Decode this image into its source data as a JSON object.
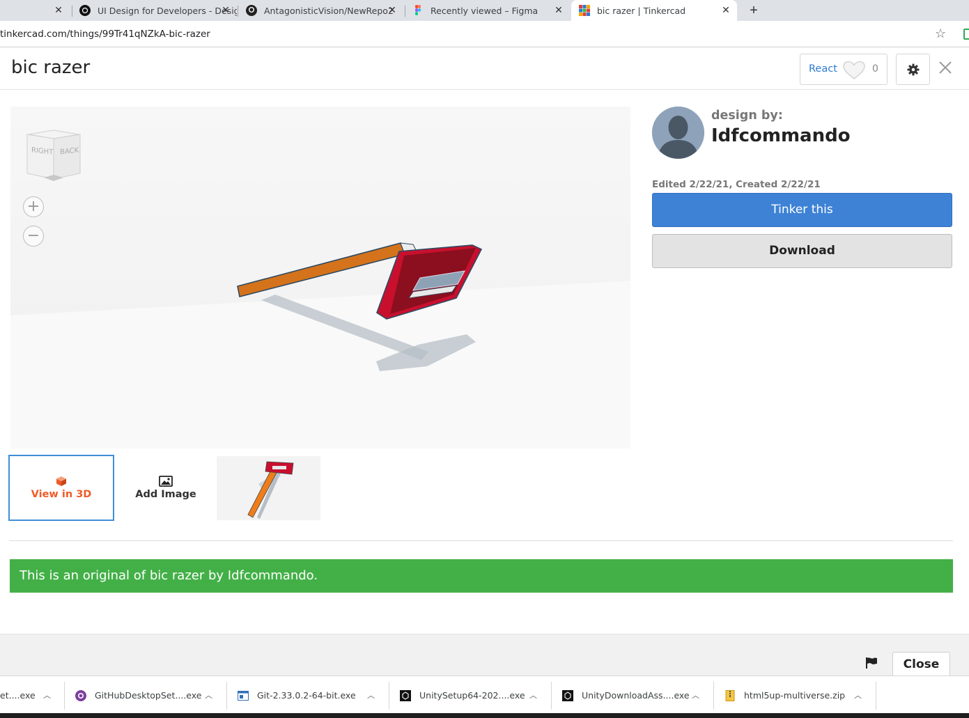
{
  "browser": {
    "tabs": [
      {
        "title": "",
        "active": false
      },
      {
        "title": "UI Design for Developers - Desig",
        "active": false
      },
      {
        "title": "AntagonisticVision/NewRepo2",
        "active": false
      },
      {
        "title": "Recently viewed – Figma",
        "active": false
      },
      {
        "title": "bic razer | Tinkercad",
        "active": true
      }
    ],
    "new_tab": "+",
    "url": "tinkercad.com/things/99Tr41qNZkA-bic-razer"
  },
  "modal": {
    "title": "bic razer",
    "react_label": "React",
    "react_count": "0",
    "viewcube": {
      "right": "RIGHT",
      "back": "BACK"
    },
    "zoom_in": "+",
    "zoom_out": "−",
    "thumbs": {
      "view3d_label": "View in 3D",
      "add_image_label": "Add Image"
    },
    "designer": {
      "design_by": "design by:",
      "name": "Idfcommando",
      "edited": "Edited 2/22/21, Created 2/22/21"
    },
    "tinker_label": "Tinker this",
    "download_label": "Download",
    "banner": "This is an original of bic razer by Idfcommando.",
    "close_label": "Close"
  },
  "downloads": [
    {
      "name": "et....exe",
      "icon": "exe-icon"
    },
    {
      "name": "GitHubDesktopSet....exe",
      "icon": "github-icon"
    },
    {
      "name": "Git-2.33.0.2-64-bit.exe",
      "icon": "installer-icon"
    },
    {
      "name": "UnitySetup64-202....exe",
      "icon": "unity-icon"
    },
    {
      "name": "UnityDownloadAss....exe",
      "icon": "unity-icon"
    },
    {
      "name": "html5up-multiverse.zip",
      "icon": "zip-icon"
    }
  ],
  "colors": {
    "accent_blue": "#3e82d6",
    "banner_green": "#43b047",
    "view3d_orange": "#f05a28"
  }
}
